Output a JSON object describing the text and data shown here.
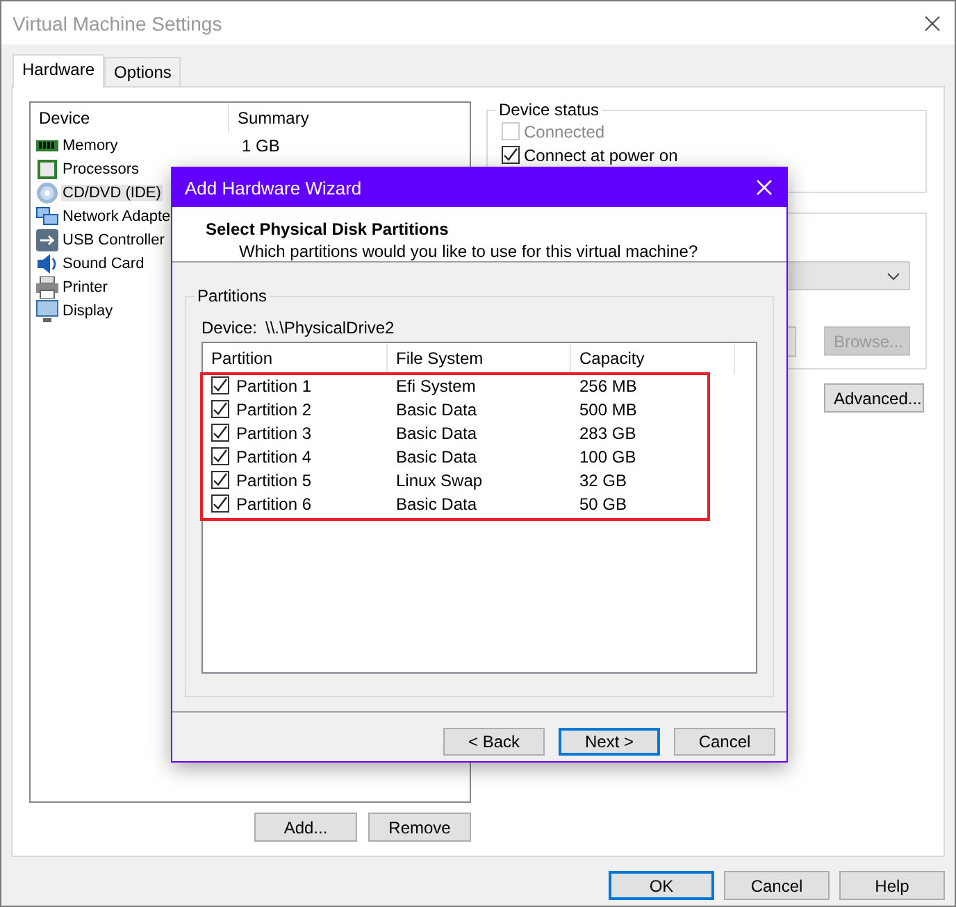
{
  "window": {
    "title": "Virtual Machine Settings"
  },
  "tabs": [
    {
      "label": "Hardware",
      "selected": true
    },
    {
      "label": "Options",
      "selected": false
    }
  ],
  "devices": {
    "columns": [
      "Device",
      "Summary"
    ],
    "rows": [
      {
        "kind": "memory",
        "name": "Memory",
        "summary": "1 GB",
        "selected": false
      },
      {
        "kind": "processor",
        "name": "Processors",
        "selected": false
      },
      {
        "kind": "disc",
        "name": "CD/DVD (IDE)",
        "selected": true
      },
      {
        "kind": "network",
        "name": "Network Adapte",
        "selected": false
      },
      {
        "kind": "usb",
        "name": "USB Controller",
        "selected": false
      },
      {
        "kind": "sound",
        "name": "Sound Card",
        "selected": false
      },
      {
        "kind": "printer",
        "name": "Printer",
        "selected": false
      },
      {
        "kind": "display",
        "name": "Display",
        "selected": false
      }
    ]
  },
  "device_buttons": [
    "Add...",
    "Remove"
  ],
  "device_status": {
    "title": "Device status",
    "options": [
      {
        "label": "Connected",
        "checked": false,
        "disabled": true
      },
      {
        "label": "Connect at power on",
        "checked": true,
        "disabled": false
      }
    ]
  },
  "browse_button": {
    "label": "Browse...",
    "disabled": true
  },
  "advanced_button": "Advanced...",
  "buttons": [
    {
      "label": "OK",
      "focused": true
    },
    {
      "label": "Cancel",
      "focused": false
    },
    {
      "label": "Help",
      "focused": false
    }
  ],
  "wizard": {
    "title": "Add Hardware Wizard",
    "heading": "Select Physical Disk Partitions",
    "subheading": "Which partitions would you like to use for this virtual machine?",
    "group_title": "Partitions",
    "device_label": "Device:",
    "device_path": "\\\\.\\PhysicalDrive2",
    "columns": [
      "Partition",
      "File System",
      "Capacity"
    ],
    "rows": [
      {
        "partition": "Partition 1",
        "file_system": "Efi System",
        "capacity": "256 MB",
        "checked": true
      },
      {
        "partition": "Partition 2",
        "file_system": "Basic Data",
        "capacity": "500 MB",
        "checked": true
      },
      {
        "partition": "Partition 3",
        "file_system": "Basic Data",
        "capacity": "283 GB",
        "checked": true
      },
      {
        "partition": "Partition 4",
        "file_system": "Basic Data",
        "capacity": "100 GB",
        "checked": true
      },
      {
        "partition": "Partition 5",
        "file_system": "Linux Swap",
        "capacity": "32 GB",
        "checked": true
      },
      {
        "partition": "Partition 6",
        "file_system": "Basic Data",
        "capacity": "50 GB",
        "checked": true
      }
    ],
    "buttons": [
      {
        "label": "< Back",
        "focused": false
      },
      {
        "label": "Next >",
        "focused": true
      },
      {
        "label": "Cancel",
        "focused": false
      }
    ]
  }
}
